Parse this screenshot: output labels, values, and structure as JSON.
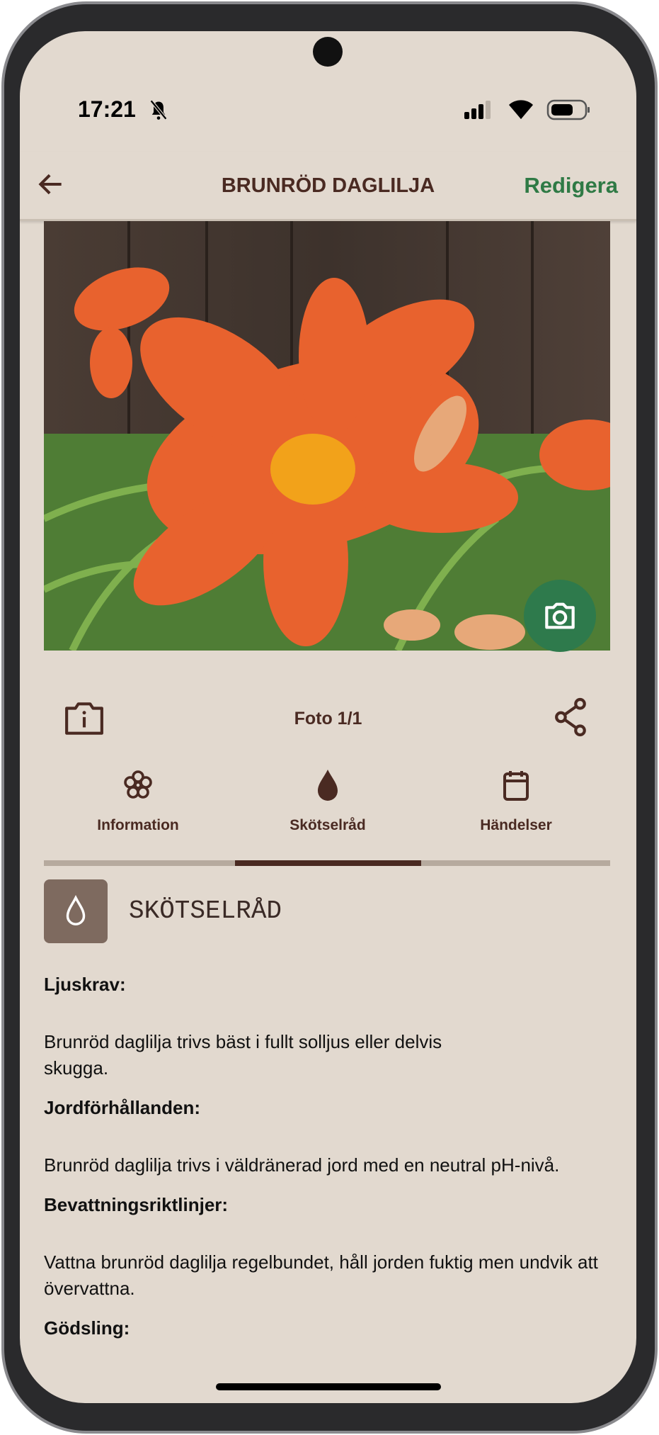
{
  "status": {
    "time": "17:21",
    "icons": [
      "bell-off-icon",
      "signal-icon",
      "wifi-icon",
      "battery-icon"
    ]
  },
  "appbar": {
    "title": "BRUNRÖD DAGLILJA",
    "edit": "Redigera"
  },
  "photo": {
    "counter": "Foto 1/1"
  },
  "tabs": [
    {
      "label": "Information",
      "icon": "flower-icon"
    },
    {
      "label": "Skötselråd",
      "icon": "drop-icon"
    },
    {
      "label": "Händelser",
      "icon": "calendar-icon"
    }
  ],
  "active_tab": 1,
  "section": {
    "title": "SKÖTSELRÅD"
  },
  "care": [
    {
      "heading": "Ljuskrav:",
      "text": "Brunröd daglilja trivs bäst i fullt solljus eller delvis skugga."
    },
    {
      "heading": "Jordförhållanden:",
      "text": "Brunröd daglilja trivs i väldränerad jord med en neutral pH-nivå."
    },
    {
      "heading": "Bevattningsriktlinjer:",
      "text": "Vattna brunröd daglilja regelbundet, håll jorden fuktig men undvik att övervattna."
    },
    {
      "heading": "Gödsling:",
      "text": ""
    }
  ],
  "colors": {
    "background": "#e2d9cf",
    "accent": "#2f7a45",
    "text": "#4a2a22"
  }
}
